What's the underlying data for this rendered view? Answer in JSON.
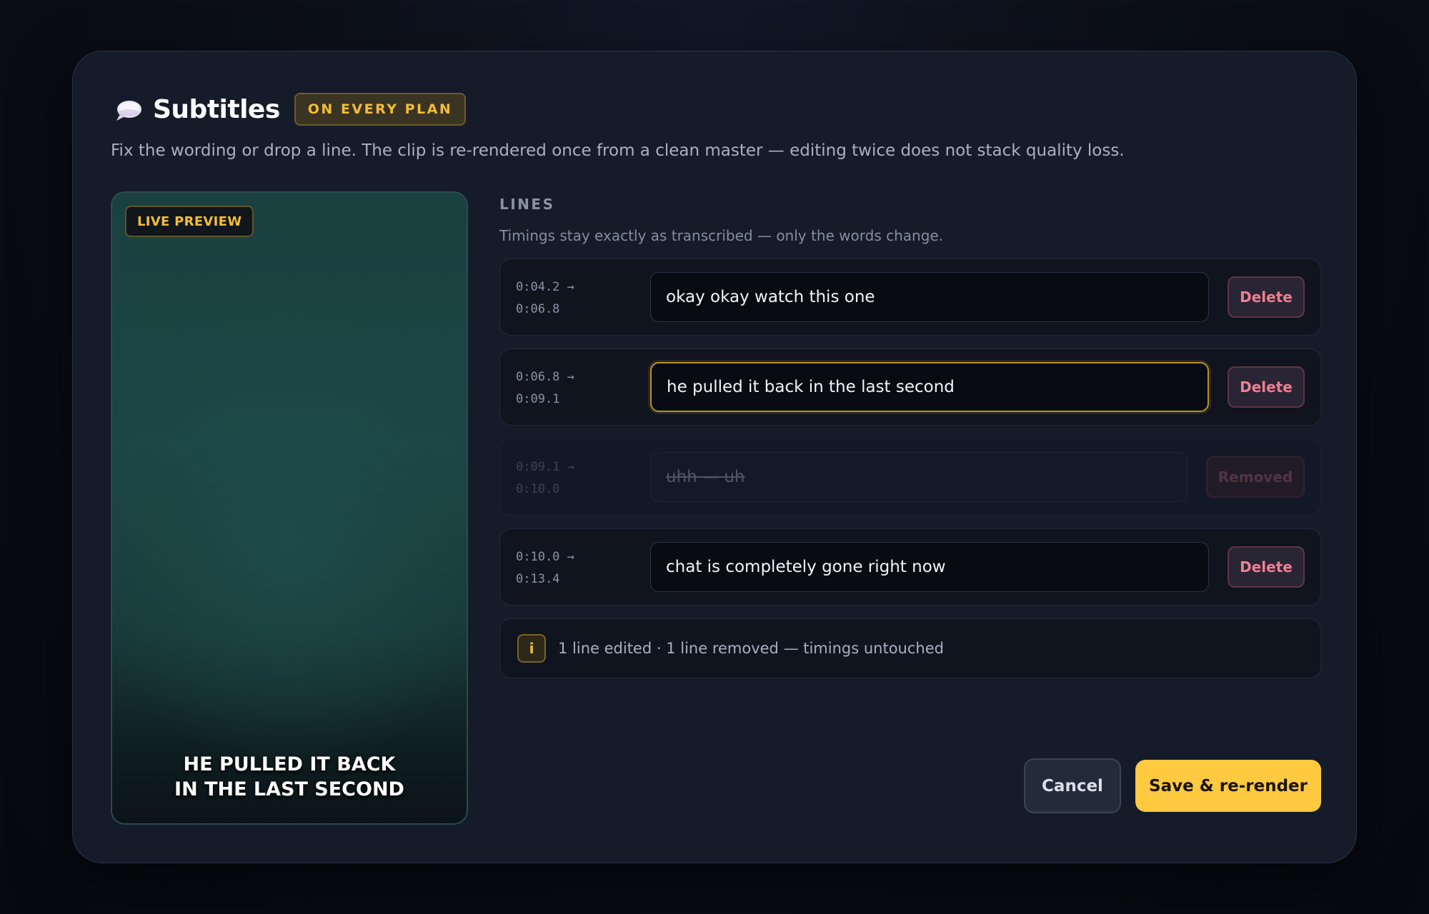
{
  "dialog": {
    "title": "Subtitles",
    "plan_badge": "ON EVERY PLAN",
    "description": "Fix the wording or drop a line. The clip is re-rendered once from a clean master — editing twice does not stack quality loss.",
    "icon": "speech-bubble-icon"
  },
  "preview": {
    "badge": "LIVE PREVIEW",
    "caption_line1": "HE PULLED IT BACK",
    "caption_line2": "IN THE LAST SECOND"
  },
  "lines": {
    "label": "LINES",
    "hint": "Timings stay exactly as transcribed — only the words change.",
    "rows": [
      {
        "start": "0:04.2 →",
        "end": "0:06.8",
        "text": "okay okay watch this one",
        "action": "Delete",
        "state": "normal"
      },
      {
        "start": "0:06.8 →",
        "end": "0:09.1",
        "text": "he pulled it back in the last second",
        "action": "Delete",
        "state": "edited"
      },
      {
        "start": "0:09.1 →",
        "end": "0:10.0",
        "text": "uhh — uh",
        "action": "Removed",
        "state": "removed"
      },
      {
        "start": "0:10.0 →",
        "end": "0:13.4",
        "text": "chat is completely gone right now",
        "action": "Delete",
        "state": "normal"
      }
    ]
  },
  "summary": {
    "icon_label": "i",
    "text": "1 line edited · 1 line removed — timings untouched"
  },
  "actions": {
    "cancel": "Cancel",
    "save": "Save & re-render"
  },
  "colors": {
    "accent": "#ffc940",
    "danger": "#ef7f91",
    "background": "#151b29"
  }
}
